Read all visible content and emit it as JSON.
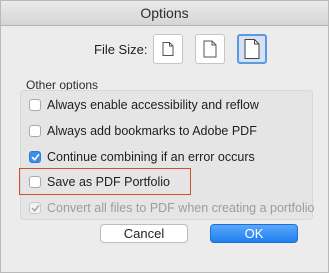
{
  "window": {
    "title": "Options"
  },
  "file_size": {
    "label": "File Size:",
    "options": [
      {
        "icon": "small-file-icon",
        "selected": false
      },
      {
        "icon": "medium-file-icon",
        "selected": false
      },
      {
        "icon": "large-file-icon",
        "selected": true
      }
    ]
  },
  "other_options": {
    "label": "Other options",
    "items": [
      {
        "label": "Always enable accessibility and reflow",
        "checked": false,
        "enabled": true
      },
      {
        "label": "Always add bookmarks to Adobe PDF",
        "checked": false,
        "enabled": true
      },
      {
        "label": "Continue combining if an error occurs",
        "checked": true,
        "enabled": true
      },
      {
        "label": "Save as PDF Portfolio",
        "checked": false,
        "enabled": true,
        "highlighted": true
      },
      {
        "label": "Convert all files to PDF when creating a portfolio",
        "checked": true,
        "enabled": false
      }
    ]
  },
  "buttons": {
    "cancel": "Cancel",
    "ok": "OK"
  },
  "colors": {
    "accent": "#3e8ee8",
    "highlight_border": "#d0502e"
  }
}
